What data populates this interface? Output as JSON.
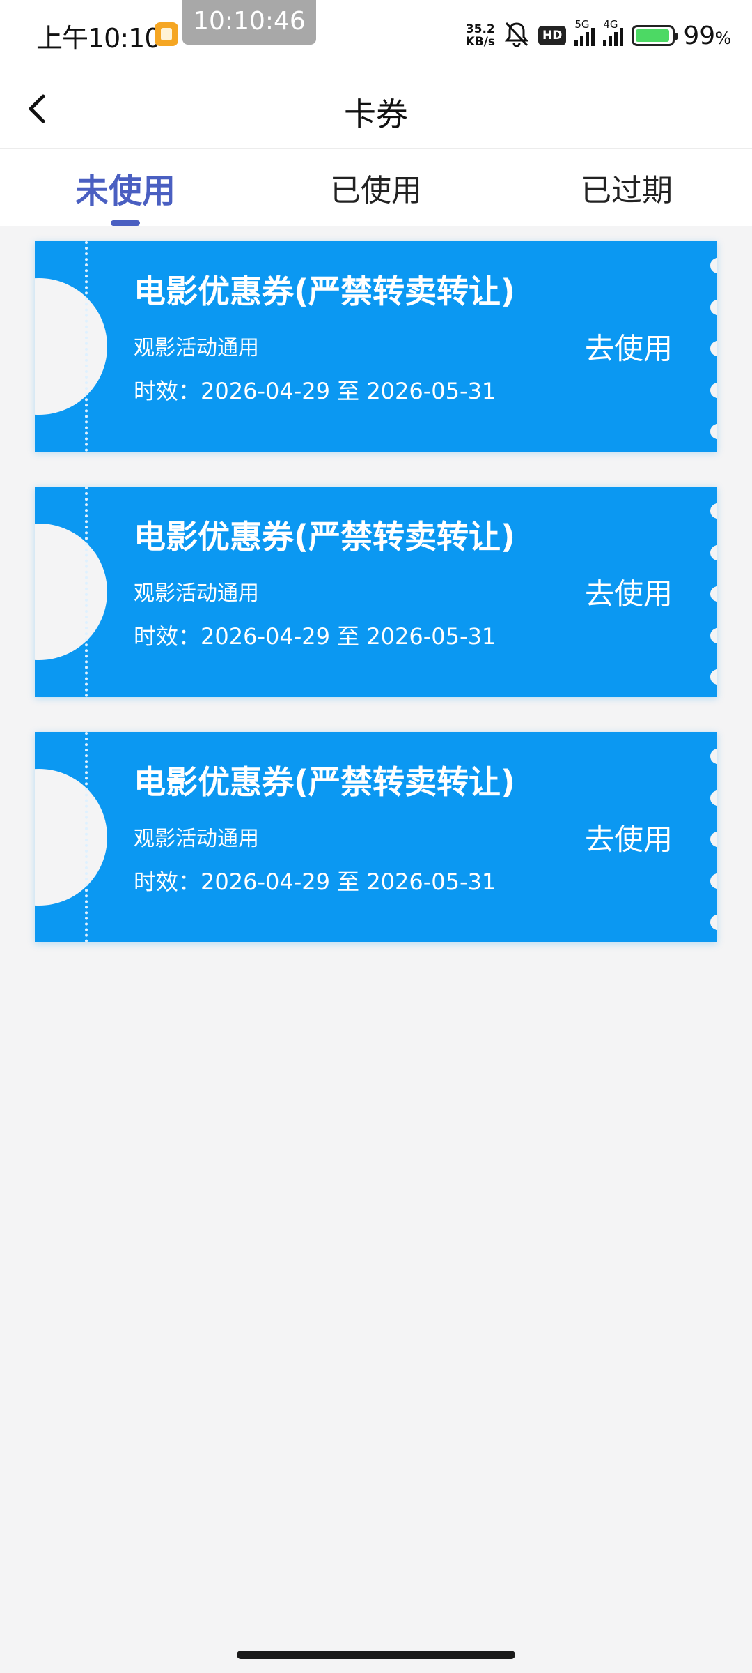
{
  "status_bar": {
    "time": "上午10:10",
    "clock_overlay": "10:10:46",
    "net_speed_value": "35.2",
    "net_speed_unit": "KB/s",
    "hd_badge": "HD",
    "signal1_label": "5G",
    "signal2_label": "4G",
    "battery_percent": "99",
    "battery_percent_unit": "%",
    "app_icon": "orange-app-icon",
    "mute_icon": "bell-off-icon"
  },
  "header": {
    "title": "卡券",
    "back_icon": "chevron-left-icon"
  },
  "tabs": [
    {
      "label": "未使用",
      "active": true
    },
    {
      "label": "已使用",
      "active": false
    },
    {
      "label": "已过期",
      "active": false
    }
  ],
  "coupons": [
    {
      "title": "电影优惠券(严禁转卖转让)",
      "description": "观影活动通用",
      "validity": "时效：2026-04-29 至 2026-05-31",
      "action": "去使用"
    },
    {
      "title": "电影优惠券(严禁转卖转让)",
      "description": "观影活动通用",
      "validity": "时效：2026-04-29 至 2026-05-31",
      "action": "去使用"
    },
    {
      "title": "电影优惠券(严禁转卖转让)",
      "description": "观影活动通用",
      "validity": "时效：2026-04-29 至 2026-05-31",
      "action": "去使用"
    }
  ],
  "colors": {
    "coupon_bg": "#0b98f2",
    "tab_active": "#4a5fc1",
    "page_bg": "#f4f4f5"
  }
}
